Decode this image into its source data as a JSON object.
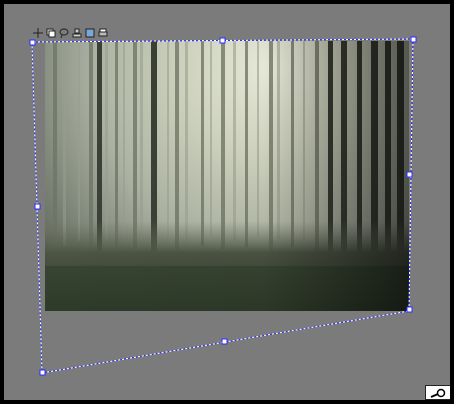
{
  "app": {
    "background_color": "#7b7b7b",
    "frame_color": "#000000",
    "selection_color": "#2b2bff"
  },
  "toolbar": {
    "icons": [
      {
        "name": "move-icon"
      },
      {
        "name": "copy-icon"
      },
      {
        "name": "lasso-icon"
      },
      {
        "name": "stamp-icon"
      },
      {
        "name": "layer-icon"
      },
      {
        "name": "print-icon"
      }
    ]
  },
  "canvas": {
    "image_subject": "misty forest",
    "tool": "free-transform"
  },
  "footer": {
    "zoom_icon": "magnifier-icon"
  }
}
